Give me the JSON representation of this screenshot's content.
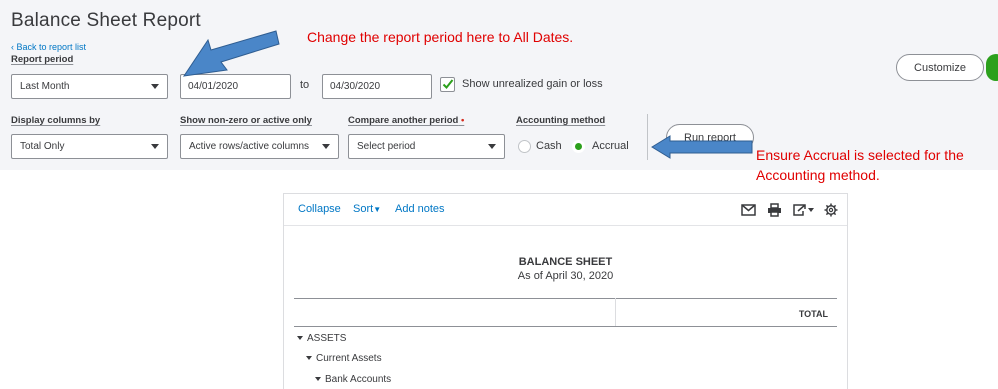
{
  "header": {
    "title": "Balance Sheet Report",
    "back_link": "Back to report list"
  },
  "filters": {
    "report_period_label": "Report period",
    "report_period_value": "Last Month",
    "date_from": "04/01/2020",
    "to_label": "to",
    "date_to": "04/30/2020",
    "unrealized_label": "Show unrealized gain or loss",
    "display_columns_label": "Display columns by",
    "display_columns_value": "Total Only",
    "nonzero_label": "Show non-zero or active only",
    "nonzero_value": "Active rows/active columns",
    "compare_label": "Compare another period",
    "compare_required": "•",
    "compare_value": "Select period",
    "accounting_label": "Accounting method",
    "cash_label": "Cash",
    "accrual_label": "Accrual",
    "run_report": "Run report",
    "customize": "Customize"
  },
  "annotations": {
    "note1": "Change the report period here to All Dates.",
    "note2_line1": "Ensure Accrual is selected for the",
    "note2_line2": "Accounting method."
  },
  "report": {
    "toolbar": {
      "collapse": "Collapse",
      "sort": "Sort",
      "add_notes": "Add notes"
    },
    "title": "BALANCE SHEET",
    "subtitle": "As of April 30, 2020",
    "column_header": "TOTAL",
    "rows": [
      "ASSETS",
      "Current Assets",
      "Bank Accounts"
    ]
  },
  "colors": {
    "arrow": "#4a86c8",
    "annotation_text": "#e00000",
    "accent_green": "#2ca01c",
    "link_blue": "#0077c5"
  }
}
